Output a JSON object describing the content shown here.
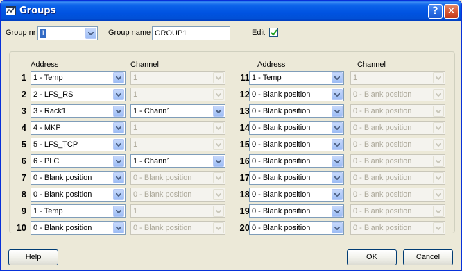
{
  "window": {
    "title": "Groups",
    "help_glyph": "?",
    "close_glyph": "✕"
  },
  "header": {
    "group_nr_label": "Group nr",
    "group_nr_value": "1",
    "group_name_label": "Group name",
    "group_name_value": "GROUP1",
    "edit_label": "Edit",
    "edit_checked": true
  },
  "columns": {
    "left_address": "Address",
    "left_channel": "Channel",
    "right_address": "Address",
    "right_channel": "Channel"
  },
  "left_rows": [
    {
      "num": "1",
      "address": "1 - Temp",
      "channel": "1",
      "channel_enabled": false
    },
    {
      "num": "2",
      "address": "2 - LFS_RS",
      "channel": "1",
      "channel_enabled": false
    },
    {
      "num": "3",
      "address": "3 - Rack1",
      "channel": "1 - Chann1",
      "channel_enabled": true
    },
    {
      "num": "4",
      "address": "4 - MKP",
      "channel": "1",
      "channel_enabled": false
    },
    {
      "num": "5",
      "address": "5 - LFS_TCP",
      "channel": "1",
      "channel_enabled": false
    },
    {
      "num": "6",
      "address": "6 - PLC",
      "channel": "1 - Chann1",
      "channel_enabled": true
    },
    {
      "num": "7",
      "address": "0 - Blank position",
      "channel": "0 - Blank position",
      "channel_enabled": false
    },
    {
      "num": "8",
      "address": "0 - Blank position",
      "channel": "0 - Blank position",
      "channel_enabled": false
    },
    {
      "num": "9",
      "address": "1 - Temp",
      "channel": "1",
      "channel_enabled": false
    },
    {
      "num": "10",
      "address": "0 - Blank position",
      "channel": "0 - Blank position",
      "channel_enabled": false
    }
  ],
  "right_rows": [
    {
      "num": "11",
      "address": "1 - Temp",
      "channel": "1",
      "channel_enabled": false
    },
    {
      "num": "12",
      "address": "0 - Blank position",
      "channel": "0 - Blank position",
      "channel_enabled": false
    },
    {
      "num": "13",
      "address": "0 - Blank position",
      "channel": "0 - Blank position",
      "channel_enabled": false
    },
    {
      "num": "14",
      "address": "0 - Blank position",
      "channel": "0 - Blank position",
      "channel_enabled": false
    },
    {
      "num": "15",
      "address": "0 - Blank position",
      "channel": "0 - Blank position",
      "channel_enabled": false
    },
    {
      "num": "16",
      "address": "0 - Blank position",
      "channel": "0 - Blank position",
      "channel_enabled": false
    },
    {
      "num": "17",
      "address": "0 - Blank position",
      "channel": "0 - Blank position",
      "channel_enabled": false
    },
    {
      "num": "18",
      "address": "0 - Blank position",
      "channel": "0 - Blank position",
      "channel_enabled": false
    },
    {
      "num": "19",
      "address": "0 - Blank position",
      "channel": "0 - Blank position",
      "channel_enabled": false
    },
    {
      "num": "20",
      "address": "0 - Blank position",
      "channel": "0 - Blank position",
      "channel_enabled": false
    }
  ],
  "buttons": {
    "help": "Help",
    "ok": "OK",
    "cancel": "Cancel"
  },
  "colors": {
    "titlebar": "#0053e1",
    "dialog_bg": "#ece9d8",
    "selection": "#316ac5"
  }
}
